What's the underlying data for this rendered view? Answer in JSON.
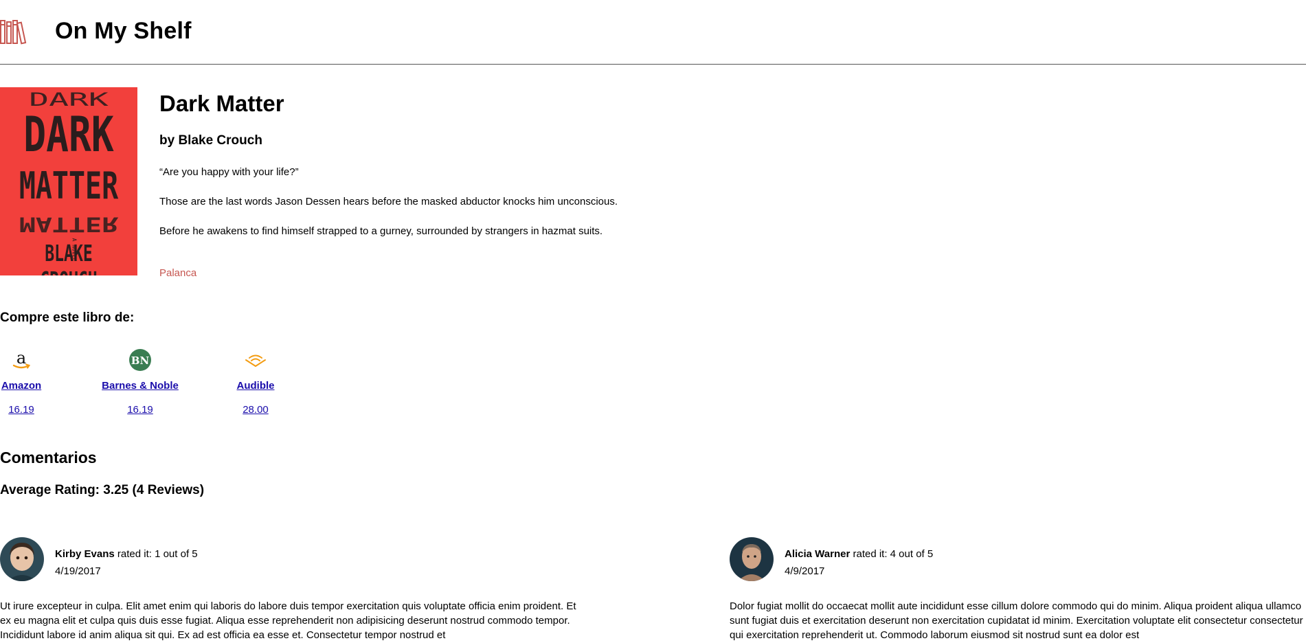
{
  "header": {
    "title": "On My Shelf",
    "logo_icon": "books-icon",
    "accent": "#c65650"
  },
  "book": {
    "cover_lines": [
      "DARK",
      "MATTER",
      "BLAKE CROUCH",
      "A NOVEL"
    ],
    "title": "Dark Matter",
    "author": "by Blake Crouch",
    "description": [
      "“Are you happy with your life?”",
      "Those are the last words Jason Dessen hears before the masked abductor knocks him unconscious.",
      "Before he awakens to find himself strapped to a gurney, surrounded by strangers in hazmat suits."
    ],
    "publisher": "Palanca"
  },
  "buy": {
    "heading": "Compre este libro de:",
    "stores": [
      {
        "name": "Amazon",
        "price": "16.19",
        "icon": "amazon-icon"
      },
      {
        "name": "Barnes & Noble",
        "price": "16.19",
        "icon": "barnes-noble-icon"
      },
      {
        "name": "Audible",
        "price": "28.00",
        "icon": "audible-icon"
      }
    ]
  },
  "comments": {
    "heading": "Comentarios",
    "average": "Average Rating: 3.25 (4 Reviews)",
    "reviews": [
      {
        "name": "Kirby Evans",
        "rated_text": "rated it: 1 out of 5",
        "date": "4/19/2017",
        "body": "Ut irure excepteur in culpa. Elit amet enim qui laboris do labore duis tempor exercitation quis voluptate officia enim proident. Et ex eu magna elit et culpa quis duis esse fugiat. Aliqua esse reprehenderit non adipisicing deserunt nostrud commodo tempor. Incididunt labore id anim aliqua sit qui. Ex ad est officia ea esse et. Consectetur tempor nostrud et"
      },
      {
        "name": "Alicia Warner",
        "rated_text": "rated it: 4 out of 5",
        "date": "4/9/2017",
        "body": "Dolor fugiat mollit do occaecat mollit aute incididunt esse cillum dolore commodo qui do minim. Aliqua proident aliqua ullamco sunt fugiat duis et exercitation deserunt non exercitation cupidatat id minim. Exercitation voluptate elit consectetur consectetur qui exercitation reprehenderit ut. Commodo laborum eiusmod sit nostrud sunt ea dolor est"
      }
    ]
  }
}
